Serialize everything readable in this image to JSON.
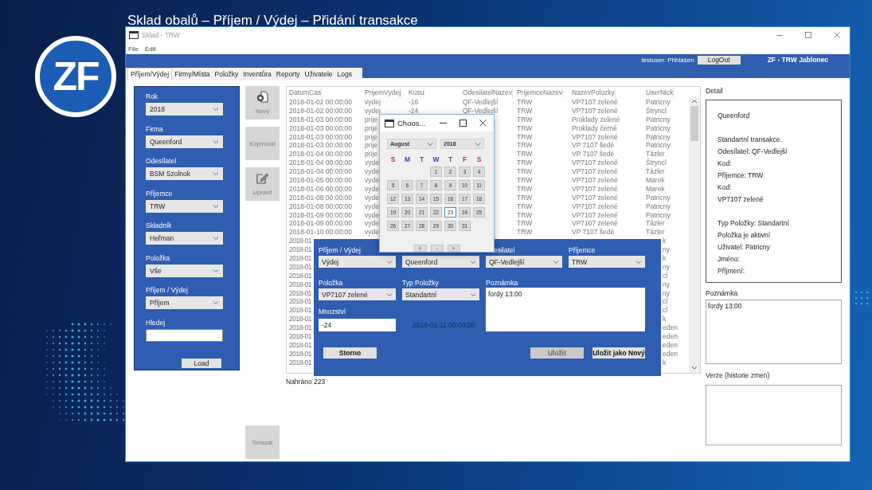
{
  "slide": {
    "title": "Sklad obalů – Příjem / Výdej – Přidání transakce",
    "logo": "ZF"
  },
  "window": {
    "title": "Sklad - TRW",
    "menu": [
      "File",
      "Edit"
    ],
    "header": {
      "user_status": "testuser: Přihlášen",
      "logout": "LogOut",
      "company": "ZF - TRW Jablonec"
    },
    "tabs": [
      {
        "label": "Příjem/Výdej",
        "selected": true
      },
      {
        "label": "Firmy/Místa",
        "selected": false
      },
      {
        "label": "Položky",
        "selected": false
      },
      {
        "label": "Inventůra",
        "selected": false
      },
      {
        "label": "Reporty",
        "selected": false
      },
      {
        "label": "Uživatele",
        "selected": false
      },
      {
        "label": "Logs",
        "selected": false
      }
    ],
    "filters": {
      "fields": [
        {
          "label": "Rok",
          "value": "2018",
          "kind": "select"
        },
        {
          "label": "Firma",
          "value": "Queenford",
          "kind": "select"
        },
        {
          "label": "Odesílatel",
          "value": "BSM Szolnok",
          "kind": "select"
        },
        {
          "label": "Příjemce",
          "value": "TRW",
          "kind": "select"
        },
        {
          "label": "Skladník",
          "value": "Heřman",
          "kind": "select"
        },
        {
          "label": "Položka",
          "value": "Vše",
          "kind": "select"
        },
        {
          "label": "Příjem / Výdej",
          "value": "Příjem",
          "kind": "select"
        },
        {
          "label": "Hledej",
          "kind": "input"
        }
      ],
      "load_button": "Load"
    },
    "actions": [
      {
        "label": "Nový",
        "kind": "add",
        "disabled": true
      },
      {
        "label": "Kopírovat",
        "kind": "plain",
        "disabled": true
      },
      {
        "label": "Upravit",
        "kind": "edit",
        "disabled": true
      },
      {
        "label": "Smazat",
        "kind": "plain",
        "disabled": true
      }
    ],
    "table": {
      "columns": [
        "DatumCas",
        "PrijemVydej",
        "Kusu",
        "OdesilatelNazev",
        "PrijemceNazev",
        "NazevPolozky",
        "UserNick"
      ],
      "rows": [
        {
          "kind": "full",
          "datum_cas": "2018-01-02 00:00:00",
          "prijem_vydej": "vydej",
          "kusu": "-16",
          "odesilatel_nazev": "QF-Vedlejší",
          "prijemce_nazev": "TRW",
          "nazev_polozky": "VP7107 zelené",
          "user_nick": "Patricny"
        },
        {
          "kind": "full",
          "datum_cas": "2018-01-02 00:00:00",
          "prijem_vydej": "vydej",
          "kusu": "-24",
          "odesilatel_nazev": "QF-Vedlejší",
          "prijemce_nazev": "TRW",
          "nazev_polozky": "VP7107 zelené",
          "user_nick": "Štryncl"
        },
        {
          "kind": "full",
          "datum_cas": "2018-01-03 00:00:00",
          "prijem_vydej": "prije",
          "prijemce_nazev": "TRW",
          "nazev_polozky": "Proklady zelené",
          "user_nick": "Patricny"
        },
        {
          "kind": "full",
          "datum_cas": "2018-01-03 00:00:00",
          "prijem_vydej": "prije",
          "prijemce_nazev": "TRW",
          "nazev_polozky": "Proklady černé",
          "user_nick": "Patricny"
        },
        {
          "kind": "full",
          "datum_cas": "2018-01-03 00:00:00",
          "prijem_vydej": "prije",
          "prijemce_nazev": "TRW",
          "nazev_polozky": "VP7107 zelené",
          "user_nick": "Patricny"
        },
        {
          "kind": "full",
          "datum_cas": "2018-01-03 00:00:00",
          "prijem_vydej": "prije",
          "prijemce_nazev": "TRW",
          "nazev_polozky": "VP 7107 šedé",
          "user_nick": "Patricny"
        },
        {
          "kind": "full",
          "datum_cas": "2018-01-04 00:00:00",
          "prijem_vydej": "prije",
          "prijemce_nazev": "TRW",
          "nazev_polozky": "VP 7107 šedé",
          "user_nick": "Tázler"
        },
        {
          "kind": "full",
          "datum_cas": "2018-01-04 00:00:00",
          "prijem_vydej": "vyde",
          "prijemce_nazev": "TRW",
          "nazev_polozky": "VP7107 zelené",
          "user_nick": "Štryncl"
        },
        {
          "kind": "full",
          "datum_cas": "2018-01-04 00:00:00",
          "prijem_vydej": "vyde",
          "prijemce_nazev": "TRW",
          "nazev_polozky": "VP7107 zelené",
          "user_nick": "Tázler"
        },
        {
          "kind": "full",
          "datum_cas": "2018-01-05 00:00:00",
          "prijem_vydej": "vyde",
          "prijemce_nazev": "TRW",
          "nazev_polozky": "VP7107 zelené",
          "user_nick": "Marek"
        },
        {
          "kind": "full",
          "datum_cas": "2018-01-06 00:00:00",
          "prijem_vydej": "vyde",
          "prijemce_nazev": "TRW",
          "nazev_polozky": "VP7107 zelené",
          "user_nick": "Marek"
        },
        {
          "kind": "full",
          "datum_cas": "2018-01-08 00:00:00",
          "prijem_vydej": "vyde",
          "prijemce_nazev": "TRW",
          "nazev_polozky": "VP7107 zelené",
          "user_nick": "Patricny"
        },
        {
          "kind": "full",
          "datum_cas": "2018-01-08 00:00:00",
          "prijem_vydej": "vyde",
          "prijemce_nazev": "TRW",
          "nazev_polozky": "VP7107 zelené",
          "user_nick": "Patricny"
        },
        {
          "kind": "full",
          "datum_cas": "2018-01-09 00:00:00",
          "prijem_vydej": "vyde",
          "prijemce_nazev": "TRW",
          "nazev_polozky": "VP7107 zelené",
          "user_nick": "Patricny"
        },
        {
          "kind": "full",
          "datum_cas": "2018-01-09 00:00:00",
          "prijem_vydej": "vyde",
          "prijemce_nazev": "TRW",
          "nazev_polozky": "VP7107 zelené",
          "user_nick": "Tázler"
        },
        {
          "kind": "full",
          "datum_cas": "2018-01-10 00:00:00",
          "prijem_vydej": "vyde",
          "prijemce_nazev": "TRW",
          "nazev_polozky": "VP 7107 šedé",
          "user_nick": "Tázler"
        },
        {
          "kind": "covered",
          "datum_cas": "2018-01",
          "user_nick": "k"
        },
        {
          "kind": "covered",
          "datum_cas": "2018-01",
          "user_nick": "ny"
        },
        {
          "kind": "covered",
          "datum_cas": "2018-01",
          "user_nick": "k"
        },
        {
          "kind": "covered",
          "datum_cas": "2018-01",
          "user_nick": "ny"
        },
        {
          "kind": "covered",
          "datum_cas": "2018-01",
          "user_nick": "cl"
        },
        {
          "kind": "covered",
          "datum_cas": "2018-01",
          "user_nick": "ny"
        },
        {
          "kind": "covered",
          "datum_cas": "2018-01",
          "user_nick": "ny"
        },
        {
          "kind": "covered",
          "datum_cas": "2018-01",
          "user_nick": "cl"
        },
        {
          "kind": "covered",
          "datum_cas": "2018-01",
          "user_nick": "cl"
        },
        {
          "kind": "covered",
          "datum_cas": "2018-01",
          "user_nick": "k"
        },
        {
          "kind": "covered",
          "datum_cas": "2018-01",
          "user_nick": "eden"
        },
        {
          "kind": "covered",
          "datum_cas": "2018-01",
          "user_nick": "eden"
        },
        {
          "kind": "covered",
          "datum_cas": "2018-01",
          "user_nick": "eden"
        },
        {
          "kind": "covered",
          "datum_cas": "2018-01",
          "user_nick": "eden"
        },
        {
          "kind": "covered",
          "datum_cas": "2018-01",
          "user_nick": "k"
        }
      ],
      "status": "Nahráno 223"
    },
    "detail": {
      "label": "Detail",
      "groups": [
        [
          "Queenford"
        ],
        [
          "Standartní transakce.",
          "Odesílatel: QF-Vedlejší",
          "Kod:",
          "Příjemce: TRW",
          "Kod:",
          "VP7107 zelené"
        ],
        [
          "Typ Položky: Standartní",
          "Položka je aktivní",
          "Uživatel: Patricny",
          "Jméno:",
          "Příjmení:"
        ]
      ],
      "note_label": "Poznámka",
      "note": "fordy 13:00",
      "versions_label": "Verze (historie zmen)"
    },
    "calendar": {
      "title": "Choos...",
      "month": "August",
      "year": "2018",
      "weekdays": [
        {
          "label": "S",
          "color": "#cc2b2b"
        },
        {
          "label": "M",
          "color": "#3a3fc0"
        },
        {
          "label": "T",
          "color": "#4a5a90"
        },
        {
          "label": "W",
          "color": "#3a3fc0"
        },
        {
          "label": "T",
          "color": "#4a5a90"
        },
        {
          "label": "F",
          "color": "#cc2b2b"
        },
        {
          "label": "S",
          "color": "#cc2b2b"
        }
      ],
      "weeks": [
        [
          {
            "label": "1",
            "selected": false
          },
          {
            "label": "2",
            "selected": false
          },
          {
            "label": "3",
            "selected": false
          },
          {
            "label": "4",
            "selected": false
          }
        ],
        [
          {
            "label": "5",
            "selected": false
          },
          {
            "label": "6",
            "selected": false
          },
          {
            "label": "7",
            "selected": false
          },
          {
            "label": "8",
            "selected": false
          },
          {
            "label": "9",
            "selected": false
          },
          {
            "label": "10",
            "selected": false
          },
          {
            "label": "11",
            "selected": false
          }
        ],
        [
          {
            "label": "12",
            "selected": false
          },
          {
            "label": "13",
            "selected": false
          },
          {
            "label": "14",
            "selected": false
          },
          {
            "label": "15",
            "selected": false
          },
          {
            "label": "16",
            "selected": false
          },
          {
            "label": "17",
            "selected": false
          },
          {
            "label": "18",
            "selected": false
          }
        ],
        [
          {
            "label": "19",
            "selected": false
          },
          {
            "label": "20",
            "selected": false
          },
          {
            "label": "21",
            "selected": false
          },
          {
            "label": "22",
            "selected": false
          },
          {
            "label": "23",
            "selected": true
          },
          {
            "label": "24",
            "selected": false
          },
          {
            "label": "25",
            "selected": false
          }
        ],
        [
          {
            "label": "26",
            "selected": false
          },
          {
            "label": "27",
            "selected": false
          },
          {
            "label": "28",
            "selected": false
          },
          {
            "label": "29",
            "selected": false
          },
          {
            "label": "30",
            "selected": false
          },
          {
            "label": "31",
            "selected": false
          }
        ]
      ],
      "nav": [
        "<",
        "-",
        ">"
      ]
    },
    "edit_dialog": {
      "fields": [
        {
          "label": "Příjem / Výdej",
          "value": "Výdej",
          "kind": "select"
        },
        {
          "value": "Queenford",
          "kind": "select"
        },
        {
          "label": "esilatel",
          "value": "QF-Vedlejší",
          "kind": "select"
        },
        {
          "label": "Příjemce",
          "value": "TRW",
          "kind": "select"
        },
        {
          "label": "Položka",
          "value": "VP7107 zelené",
          "kind": "select"
        },
        {
          "label": "Typ Položky",
          "value": "Standartní",
          "kind": "select"
        },
        {
          "label": "Poznámka",
          "value": "fordy 13:00",
          "kind": "textarea"
        },
        {
          "label": "Mnozství",
          "value": "-24",
          "kind": "input"
        }
      ],
      "date": "2018-01-11 00:00:00",
      "buttons": [
        {
          "label": "Storno",
          "disabled": false
        },
        {
          "label": "Uložit",
          "disabled": true
        },
        {
          "label": "Uložit jako Nový",
          "disabled": false
        }
      ]
    }
  }
}
